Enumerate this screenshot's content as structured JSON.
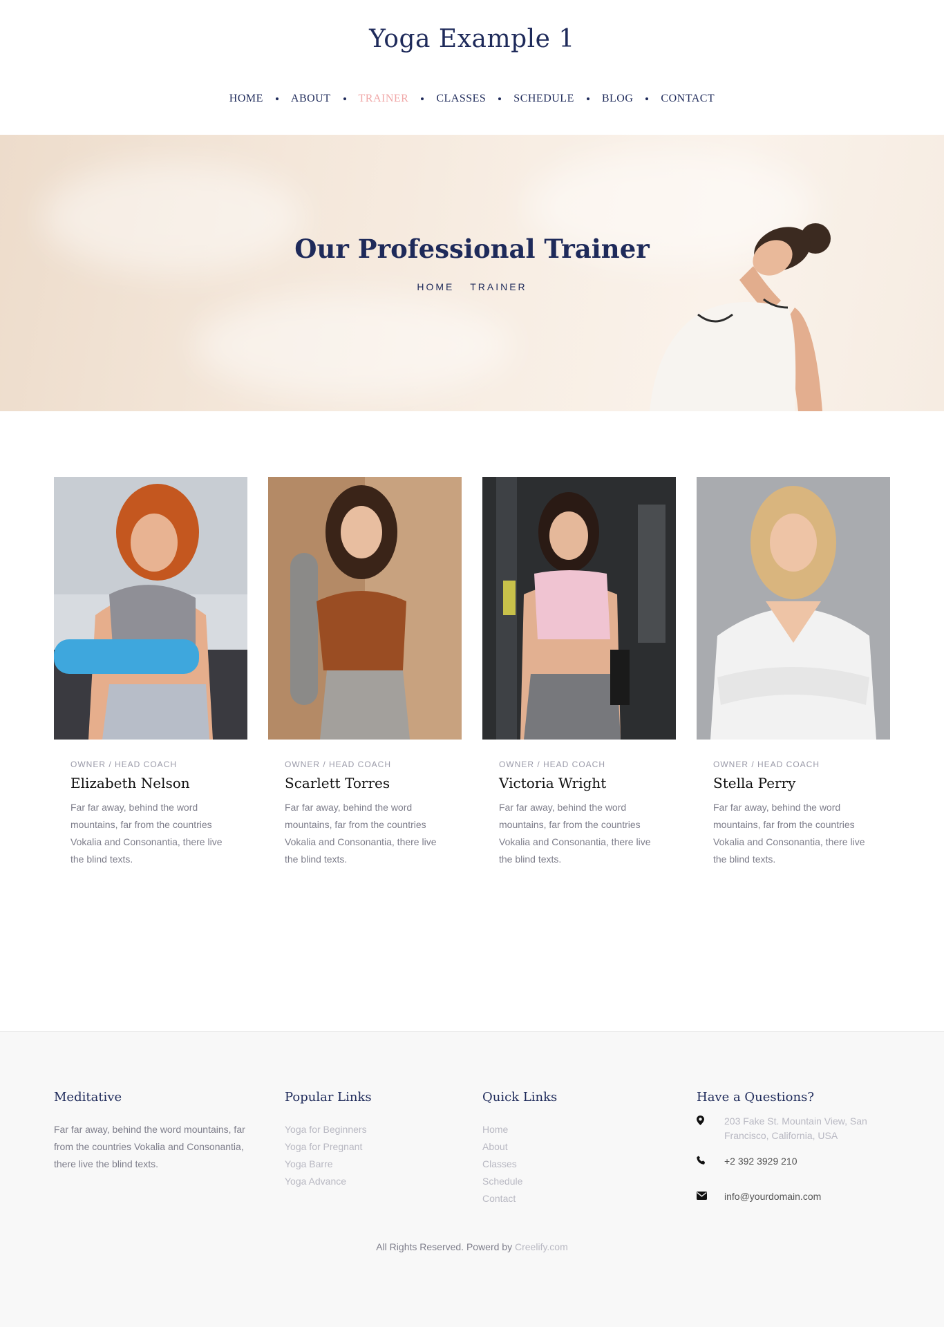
{
  "site": {
    "title": "Yoga Example 1"
  },
  "nav": {
    "items": [
      {
        "label": "HOME"
      },
      {
        "label": "ABOUT"
      },
      {
        "label": "TRAINER"
      },
      {
        "label": "CLASSES"
      },
      {
        "label": "SCHEDULE"
      },
      {
        "label": "BLOG"
      },
      {
        "label": "CONTACT"
      }
    ],
    "active_index": 2,
    "active_color": "#f0a8a8"
  },
  "hero": {
    "title": "Our Professional Trainer",
    "breadcrumb": [
      "HOME",
      "TRAINER"
    ]
  },
  "trainers": [
    {
      "role": "OWNER / HEAD COACH",
      "name": "Elizabeth Nelson",
      "bio": "Far far away, behind the word mountains, far from the countries Vokalia and Consonantia, there live the blind texts."
    },
    {
      "role": "OWNER / HEAD COACH",
      "name": "Scarlett Torres",
      "bio": "Far far away, behind the word mountains, far from the countries Vokalia and Consonantia, there live the blind texts."
    },
    {
      "role": "OWNER / HEAD COACH",
      "name": "Victoria Wright",
      "bio": "Far far away, behind the word mountains, far from the countries Vokalia and Consonantia, there live the blind texts."
    },
    {
      "role": "OWNER / HEAD COACH",
      "name": "Stella Perry",
      "bio": "Far far away, behind the word mountains, far from the countries Vokalia and Consonantia, there live the blind texts."
    }
  ],
  "footer": {
    "about": {
      "heading": "Meditative",
      "text": "Far far away, behind the word mountains, far from the countries Vokalia and Consonantia, there live the blind texts."
    },
    "popular_links": {
      "heading": "Popular Links",
      "items": [
        "Yoga for Beginners",
        "Yoga for Pregnant",
        "Yoga Barre",
        "Yoga Advance"
      ]
    },
    "quick_links": {
      "heading": "Quick Links",
      "items": [
        "Home",
        "About",
        "Classes",
        "Schedule",
        "Contact"
      ]
    },
    "contact": {
      "heading": "Have a Questions?",
      "address": "203 Fake St. Mountain View, San Francisco, California, USA",
      "phone": "+2 392 3929 210",
      "email": "info@yourdomain.com"
    },
    "copyright_prefix": "All Rights Reserved. Powerd by",
    "copyright_link": "Creelify.com"
  },
  "colors": {
    "brand_navy": "#1e2a5a",
    "accent_pink": "#f0a8a8",
    "muted_text": "#7d7d8a",
    "link_light": "#b8b8c2",
    "footer_bg": "#f8f8f8"
  }
}
